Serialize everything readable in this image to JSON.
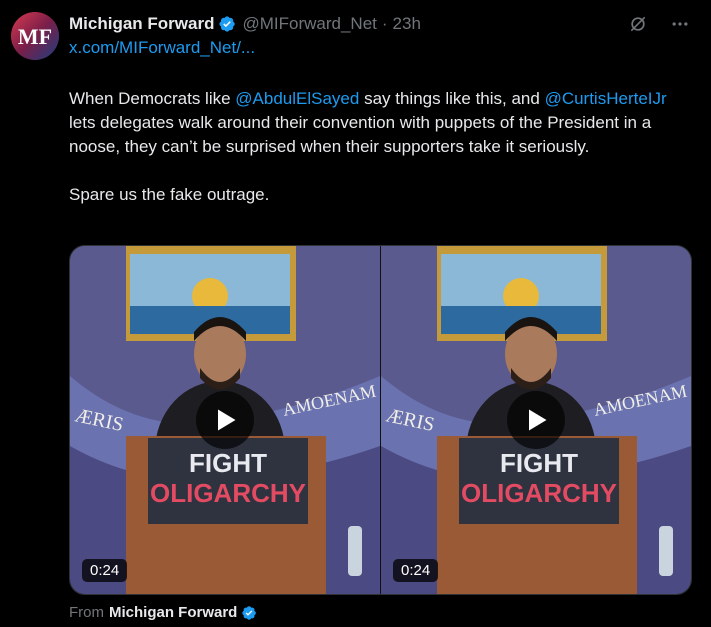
{
  "author": {
    "name": "Michigan Forward",
    "handle": "@MIForward_Net",
    "time": "23h",
    "avatar_text": "MF"
  },
  "link": "x.com/MIForward_Net/...",
  "tweet": {
    "p1_pre": "When Democrats like ",
    "mention1": "@AbdulElSayed",
    "p1_mid": " say things like this, and ",
    "mention2": "@CurtisHerteIJr",
    "p1_post": " lets delegates walk around their convention with puppets of the President in a noose, they can’t be surprised when their supporters take it seriously.",
    "p2": "Spare us the fake outrage."
  },
  "media": [
    {
      "duration": "0:24",
      "sign_top": "FIGHT",
      "sign_bottom": "OLIGARCHY"
    },
    {
      "duration": "0:24",
      "sign_top": "FIGHT",
      "sign_bottom": "OLIGARCHY"
    }
  ],
  "flag_text": {
    "left": "ÆRIS",
    "right": "AMOENAM"
  },
  "from": {
    "label": "From",
    "name": "Michigan Forward"
  },
  "icons": {
    "verified": "verified-badge-icon",
    "grok": "grok-icon",
    "more": "more-icon",
    "play": "play-icon"
  },
  "colors": {
    "accent": "#1d9bf0",
    "muted": "#71767b",
    "text": "#e7e9ea"
  }
}
